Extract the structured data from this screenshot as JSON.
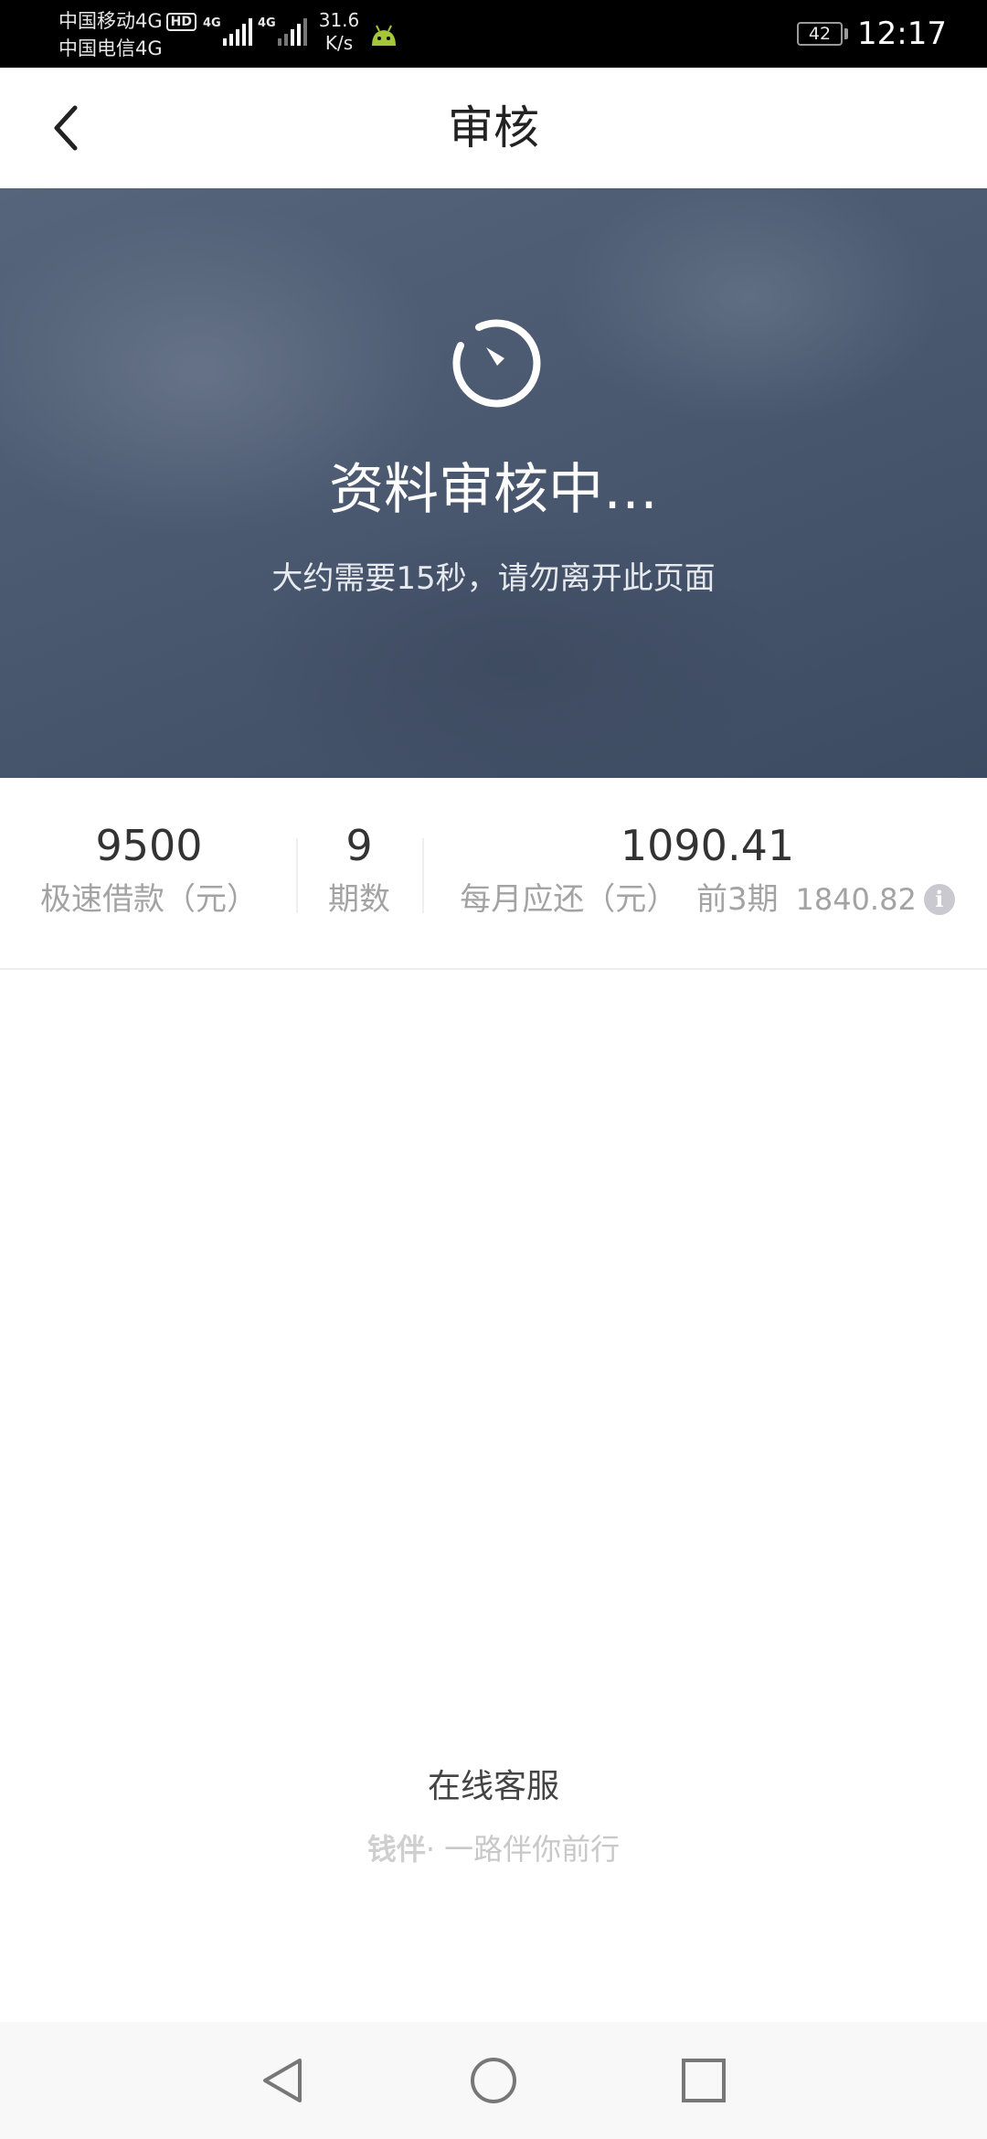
{
  "status_bar": {
    "carrier_1": "中国移动4G",
    "hd_badge": "HD",
    "carrier_2": "中国电信4G",
    "signal_1_label": "4G",
    "signal_2_label": "4G",
    "net_speed_value": "31.6",
    "net_speed_unit": "K/s",
    "battery": "42",
    "time": "12:17"
  },
  "nav": {
    "back_icon": "chevron-left-icon",
    "title": "审核"
  },
  "hero": {
    "icon": "clock-timer-icon",
    "title": "资料审核中…",
    "subtitle": "大约需要15秒，请勿离开此页面"
  },
  "summary": {
    "loan_amount": "9500",
    "loan_label": "极速借款（元）",
    "periods": "9",
    "periods_label": "期数",
    "monthly_payment": "1090.41",
    "monthly_label": "每月应还（元）",
    "first_periods_label": "前3期",
    "first_periods_amount": "1840.82",
    "info_icon": "info-icon",
    "info_glyph": "i"
  },
  "footer": {
    "service_link": "在线客服",
    "brand": "钱伴",
    "slogan": "· 一路伴你前行"
  },
  "system_nav": {
    "back": "triangle-back-icon",
    "home": "circle-home-icon",
    "recents": "square-recents-icon"
  },
  "colors": {
    "hero_bg": "#4a5870",
    "text_dark": "#333333",
    "text_muted": "#a3a3a3"
  }
}
